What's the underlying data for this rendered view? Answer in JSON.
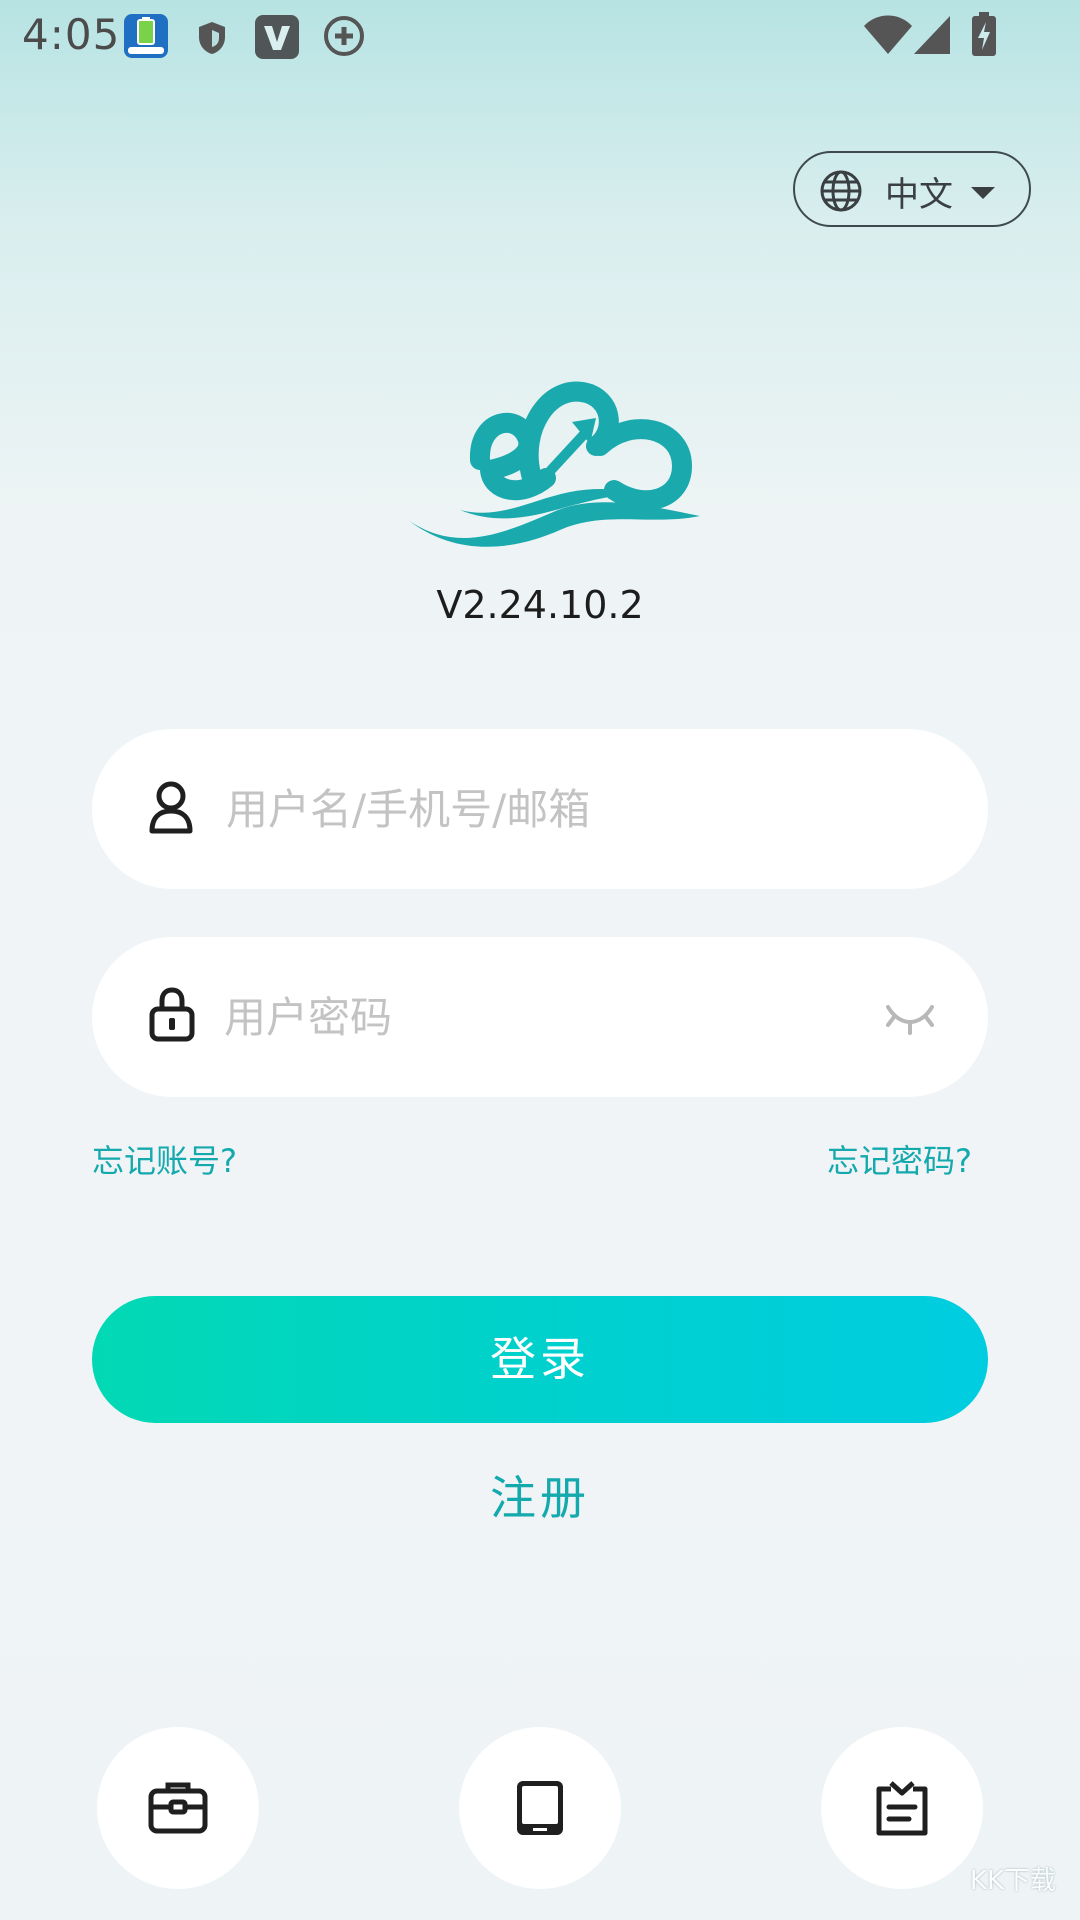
{
  "status_bar": {
    "time": "4:05",
    "icons": [
      "battery-app-icon",
      "shield-icon",
      "v-app-icon",
      "plus-circle-icon",
      "wifi-icon",
      "cell-signal-icon",
      "battery-charging-icon"
    ]
  },
  "language": {
    "label": "中文",
    "icon": "globe-icon"
  },
  "app": {
    "version": "V2.24.10.2",
    "brand_color": "#1aa9ad"
  },
  "login_form": {
    "username_placeholder": "用户名/手机号/邮箱",
    "password_placeholder": "用户密码",
    "forgot_account": "忘记账号?",
    "forgot_password": "忘记密码?",
    "login_label": "登录",
    "register_label": "注册"
  },
  "shortcuts": [
    {
      "icon": "briefcase-icon"
    },
    {
      "icon": "tablet-icon"
    },
    {
      "icon": "clipboard-icon"
    }
  ],
  "watermark": "KK下载"
}
